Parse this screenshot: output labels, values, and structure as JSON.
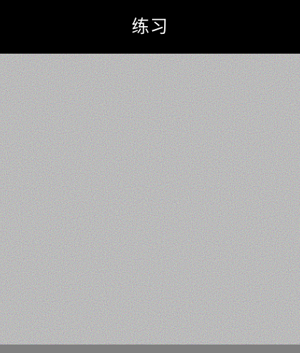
{
  "header": {
    "title": "练习"
  },
  "colors": {
    "header_background": "#000000",
    "header_text": "#ffffff",
    "canvas_background": "#808080"
  },
  "content": {
    "type": "random-noise-image"
  }
}
